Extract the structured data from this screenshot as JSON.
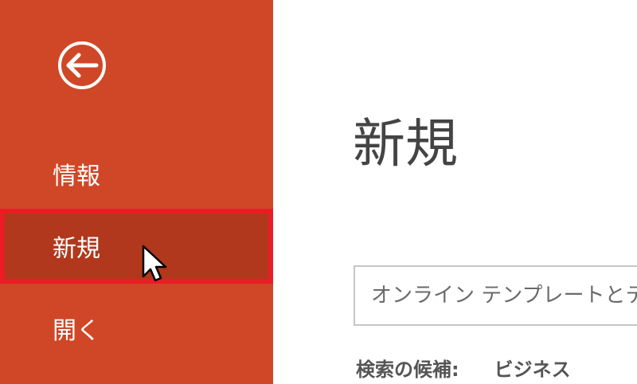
{
  "sidebar": {
    "background_color": "#d04727",
    "selected_color": "#b1381c",
    "highlight_border_color": "#ea1c24",
    "back_icon": "back-arrow-circle-icon",
    "items": [
      {
        "label": "情報"
      },
      {
        "label": "新規",
        "selected": true
      },
      {
        "label": "開く"
      }
    ]
  },
  "main": {
    "title": "新規",
    "search": {
      "placeholder": "オンライン テンプレートとテ",
      "value": ""
    },
    "suggestions": {
      "label": "検索の候補:",
      "items": [
        "ビジネス"
      ]
    }
  }
}
